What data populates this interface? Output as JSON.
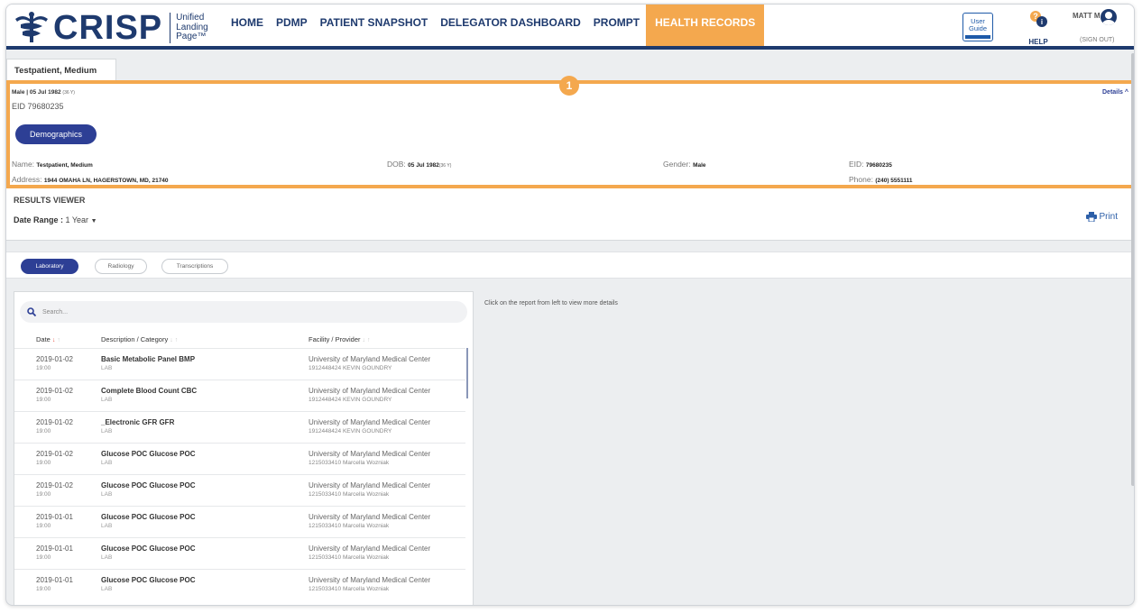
{
  "header": {
    "logo_text": "CRISP",
    "logo_sub_1": "Unified",
    "logo_sub_2": "Landing",
    "logo_sub_3": "Page™",
    "nav": [
      "HOME",
      "PDMP",
      "PATIENT SNAPSHOT",
      "DELEGATOR DASHBOARD",
      "PROMPT",
      "HEALTH RECORDS"
    ],
    "active_nav": "HEALTH RECORDS",
    "user_guide_1": "User",
    "user_guide_2": "Guide",
    "help_label": "HELP",
    "user_name": "MATT M",
    "sign_out": "(SIGN OUT)"
  },
  "patient_tab": "Testpatient, Medium",
  "step_marker": "1",
  "demographics": {
    "gender_short": "Male",
    "dob_short": "05 Jul 1982",
    "age": "(36 Y)",
    "eid_line": "EID 79680235",
    "details_link": "Details ^",
    "button": "Demographics",
    "name_label": "Name:",
    "name_value": "Testpatient, Medium",
    "dob_label": "DOB:",
    "dob_value": "05 Jul 1982",
    "dob_age": "(36 Y)",
    "gender_label": "Gender:",
    "gender_value": "Male",
    "eid_label": "EID:",
    "eid_value": "79680235",
    "address_label": "Address:",
    "address_value": "1944 OMAHA LN, HAGERSTOWN, MD, 21740",
    "phone_label": "Phone:",
    "phone_value": "(240) 5551111"
  },
  "results_viewer": {
    "title": "RESULTS VIEWER",
    "date_range_label": "Date Range :",
    "date_range_value": "1 Year",
    "print": "Print"
  },
  "tabs": [
    "Laboratory",
    "Radiology",
    "Transcriptions"
  ],
  "active_tab": "Laboratory",
  "search_placeholder": "Search...",
  "columns": {
    "date": "Date",
    "description": "Description / Category",
    "facility": "Facility / Provider"
  },
  "rows": [
    {
      "date": "2019-01-02",
      "time": "19:00",
      "description": "Basic Metabolic Panel BMP",
      "category": "LAB",
      "facility": "University of Maryland Medical Center",
      "provider": "1912448424 KEVIN GOUNDRY"
    },
    {
      "date": "2019-01-02",
      "time": "19:00",
      "description": "Complete Blood Count CBC",
      "category": "LAB",
      "facility": "University of Maryland Medical Center",
      "provider": "1912448424 KEVIN GOUNDRY"
    },
    {
      "date": "2019-01-02",
      "time": "19:00",
      "description": "_Electronic GFR GFR",
      "category": "LAB",
      "facility": "University of Maryland Medical Center",
      "provider": "1912448424 KEVIN GOUNDRY"
    },
    {
      "date": "2019-01-02",
      "time": "19:00",
      "description": "Glucose POC Glucose POC",
      "category": "LAB",
      "facility": "University of Maryland Medical Center",
      "provider": "1215033410 Marcella Wozniak"
    },
    {
      "date": "2019-01-02",
      "time": "19:00",
      "description": "Glucose POC Glucose POC",
      "category": "LAB",
      "facility": "University of Maryland Medical Center",
      "provider": "1215033410 Marcella Wozniak"
    },
    {
      "date": "2019-01-01",
      "time": "19:00",
      "description": "Glucose POC Glucose POC",
      "category": "LAB",
      "facility": "University of Maryland Medical Center",
      "provider": "1215033410 Marcella Wozniak"
    },
    {
      "date": "2019-01-01",
      "time": "19:00",
      "description": "Glucose POC Glucose POC",
      "category": "LAB",
      "facility": "University of Maryland Medical Center",
      "provider": "1215033410 Marcella Wozniak"
    },
    {
      "date": "2019-01-01",
      "time": "19:00",
      "description": "Glucose POC Glucose POC",
      "category": "LAB",
      "facility": "University of Maryland Medical Center",
      "provider": "1215033410 Marcella Wozniak"
    }
  ],
  "detail_message": "Click on the report from left to view more details",
  "colors": {
    "brand": "#1e3a6e",
    "accent": "#f4a84e",
    "button": "#2d3f95"
  }
}
